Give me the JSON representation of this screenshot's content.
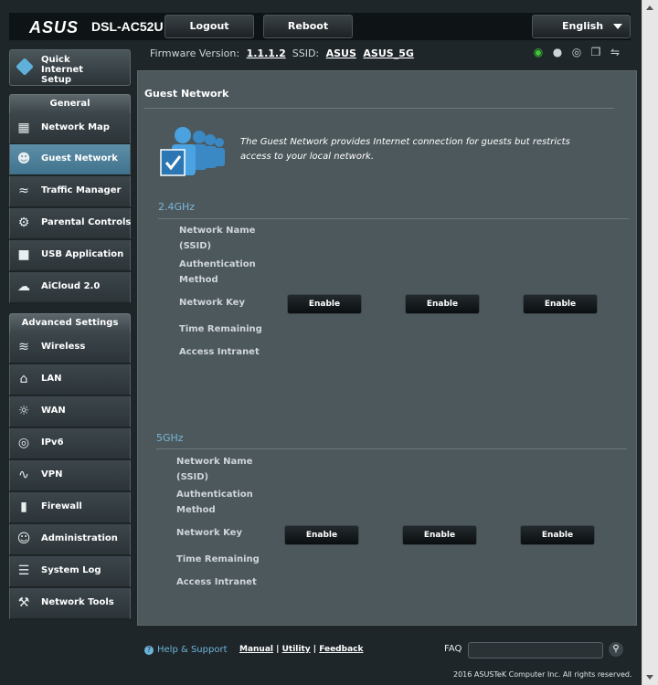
{
  "header": {
    "brand": "ASUS",
    "model": "DSL-AC52U",
    "logout": "Logout",
    "reboot": "Reboot",
    "language": "English"
  },
  "firmware": {
    "label": "Firmware Version:",
    "version": "1.1.1.2",
    "ssid_label": "SSID:",
    "ssid_1": "ASUS",
    "ssid_2": "ASUS_5G"
  },
  "sidebar": {
    "quick_setup": "Quick Internet Setup",
    "general_title": "General",
    "general_items": [
      {
        "label": "Network Map",
        "icon": "network-map-icon"
      },
      {
        "label": "Guest Network",
        "icon": "guest-network-icon"
      },
      {
        "label": "Traffic Manager",
        "icon": "traffic-manager-icon"
      },
      {
        "label": "Parental Controls",
        "icon": "parental-controls-icon"
      },
      {
        "label": "USB Application",
        "icon": "usb-application-icon"
      },
      {
        "label": "AiCloud 2.0",
        "icon": "aicloud-icon"
      }
    ],
    "advanced_title": "Advanced Settings",
    "advanced_items": [
      {
        "label": "Wireless",
        "icon": "wireless-icon"
      },
      {
        "label": "LAN",
        "icon": "lan-icon"
      },
      {
        "label": "WAN",
        "icon": "wan-icon"
      },
      {
        "label": "IPv6",
        "icon": "ipv6-icon"
      },
      {
        "label": "VPN",
        "icon": "vpn-icon"
      },
      {
        "label": "Firewall",
        "icon": "firewall-icon"
      },
      {
        "label": "Administration",
        "icon": "administration-icon"
      },
      {
        "label": "System Log",
        "icon": "system-log-icon"
      },
      {
        "label": "Network Tools",
        "icon": "network-tools-icon"
      }
    ]
  },
  "main": {
    "title": "Guest Network",
    "description": "The Guest Network provides Internet connection for guests but restricts access to your local network.",
    "bands": [
      {
        "name": "2.4GHz",
        "labels": [
          "Network Name (SSID)",
          "Authentication Method",
          "Network Key",
          "Time Remaining",
          "Access Intranet"
        ],
        "buttons": [
          "Enable",
          "Enable",
          "Enable"
        ]
      },
      {
        "name": "5GHz",
        "labels": [
          "Network Name (SSID)",
          "Authentication Method",
          "Network Key",
          "Time Remaining",
          "Access Intranet"
        ],
        "buttons": [
          "Enable",
          "Enable",
          "Enable"
        ]
      }
    ]
  },
  "footer": {
    "help": "Help & Support",
    "manual": "Manual",
    "utility": "Utility",
    "feedback": "Feedback",
    "faq": "FAQ",
    "copyright": "2016 ASUSTeK Computer Inc. All rights reserved."
  },
  "colors": {
    "accent_blue": "#7bb6d6",
    "active_item": "#4f82a0",
    "wifi_status": "#3ec83a"
  }
}
